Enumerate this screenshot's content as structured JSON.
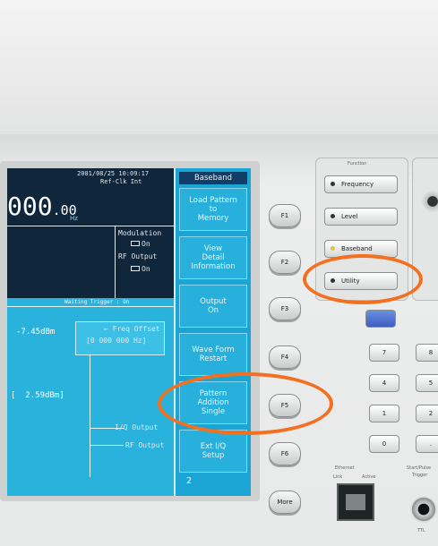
{
  "screen": {
    "timestamp": "2001/08/25  10:09:17",
    "ref_clk": "Ref-Clk Int",
    "frequency": "000",
    "frequency_decimal": ".00",
    "freq_unit": "Hz",
    "modulation_label": "Modulation",
    "modulation_value": "On",
    "rf_output_label": "RF Output",
    "rf_output_value": "On",
    "status_waiting": "Waiting",
    "status_trigger": "Trigger",
    "status_on": "On",
    "level_1": "-7.45dBm",
    "freq_offset_label": "Freq Offset",
    "freq_offset_value": "0 000 000 Hz",
    "level_2": "2.59dBm",
    "io_output": "I/Q Output",
    "rf_output_block": "RF Output",
    "page_indicator": "2"
  },
  "softkeys": {
    "title": "Baseband",
    "items": [
      {
        "label": "Load Pattern\nto\nMemory"
      },
      {
        "label": "View\nDetail\nInformation"
      },
      {
        "label": "Output\nOn"
      },
      {
        "label": "Wave Form\nRestart"
      },
      {
        "label": "Pattern\nAddition\nSingle"
      },
      {
        "label": "Ext I/Q\nSetup"
      }
    ]
  },
  "fkeys": [
    "F1",
    "F2",
    "F3",
    "F4",
    "F5",
    "F6",
    "More"
  ],
  "function_panel": {
    "title": "Function",
    "buttons": [
      "Frequency",
      "Level",
      "Baseband",
      "Utility"
    ]
  },
  "keypad": {
    "keys": [
      "7",
      "8",
      "4",
      "5",
      "1",
      "2",
      "0",
      "."
    ]
  },
  "labels": {
    "ethernet": "Ethernet",
    "link": "Link",
    "active": "Active",
    "start_pulse": "Start/Pulse",
    "trigger": "Trigger",
    "ttl": "TTL"
  },
  "colors": {
    "screen_bg": "#22b6e0",
    "highlight_ring": "#f2701f",
    "panel_bg": "#e9eaea"
  }
}
